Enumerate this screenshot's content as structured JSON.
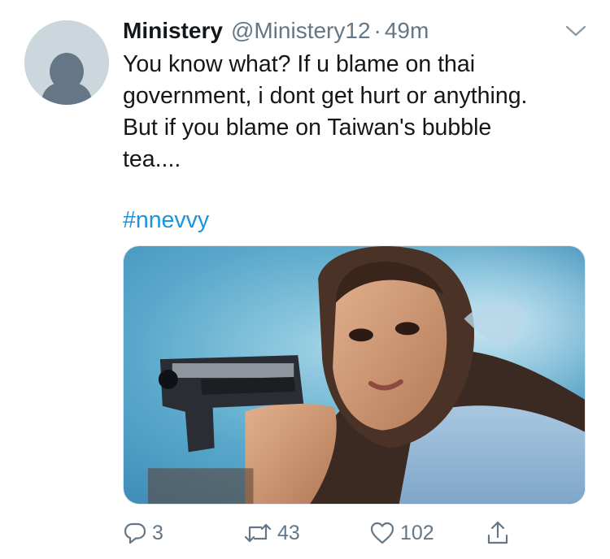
{
  "tweet": {
    "author_name": "Ministery",
    "author_handle": "@Ministery12",
    "separator": "·",
    "timestamp": "49m",
    "text_lines": [
      "You know what? If u blame on thai",
      "government, i dont get hurt or anything.",
      "But if you blame on Taiwan's bubble",
      "tea...."
    ],
    "hashtag": "#nnevvy"
  },
  "actions": {
    "reply_count": "3",
    "retweet_count": "43",
    "like_count": "102"
  },
  "icons": {
    "reply": "reply-icon",
    "retweet": "retweet-icon",
    "like": "heart-icon",
    "share": "share-icon",
    "menu": "chevron-down-icon"
  },
  "colors": {
    "text": "#14171a",
    "secondary": "#657786",
    "link": "#1b95e0",
    "avatar_bg": "#ccd6dd",
    "avatar_fg": "#657786"
  }
}
